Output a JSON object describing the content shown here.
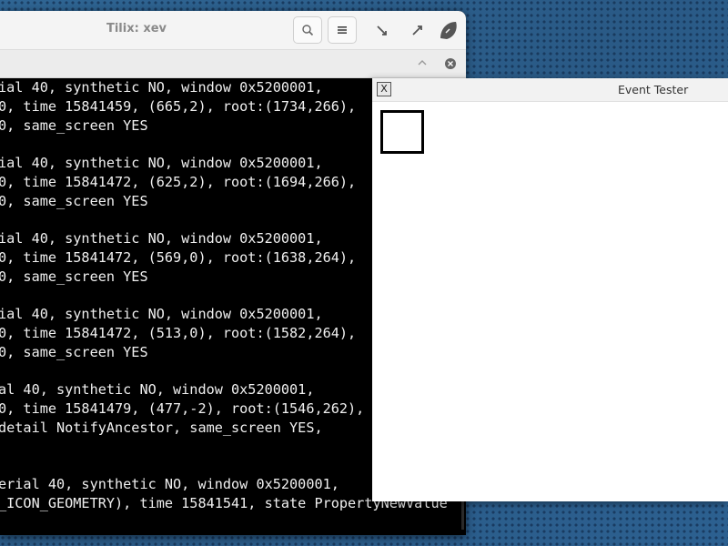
{
  "tilix": {
    "title": "Tilix: xev",
    "buttons": [
      {
        "name": "search-icon",
        "glyph": "⌕"
      },
      {
        "name": "hamburger-menu-icon",
        "glyph": "≡"
      }
    ],
    "window_controls": [
      "minimize",
      "maximize",
      "close"
    ],
    "terminal_lines": [
      "ial 40, synthetic NO, window 0x5200001,",
      "0, time 15841459, (665,2), root:(1734,266),",
      "0, same_screen YES",
      "",
      "ial 40, synthetic NO, window 0x5200001,",
      "0, time 15841472, (625,2), root:(1694,266),",
      "0, same_screen YES",
      "",
      "ial 40, synthetic NO, window 0x5200001,",
      "0, time 15841472, (569,0), root:(1638,264),",
      "0, same_screen YES",
      "",
      "ial 40, synthetic NO, window 0x5200001,",
      "0, time 15841472, (513,0), root:(1582,264),",
      "0, same_screen YES",
      "",
      "al 40, synthetic NO, window 0x5200001,",
      "0, time 15841479, (477,-2), root:(1546,262),",
      "detail NotifyAncestor, same_screen YES,",
      "",
      "",
      "erial 40, synthetic NO, window 0x5200001,",
      "_ICON_GEOMETRY), time 15841541, state PropertyNewValue"
    ]
  },
  "event_tester": {
    "title": "Event Tester",
    "icon": "x11-icon"
  },
  "colors": {
    "terminal_bg": "#000000",
    "terminal_fg": "#f0f0f0",
    "desktop_bg": "#2c5e8a"
  }
}
